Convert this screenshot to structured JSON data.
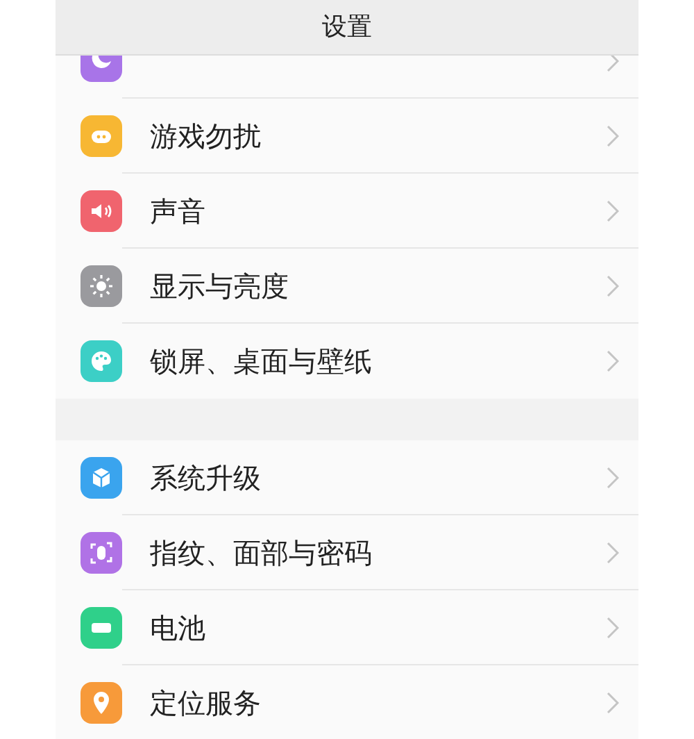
{
  "title": "设置",
  "sections": [
    {
      "items": [
        {
          "kind": "moon",
          "color": "#a874e8"
        },
        {
          "label": "游戏勿扰",
          "kind": "game",
          "color": "#f7b733"
        },
        {
          "label": "声音",
          "kind": "sound",
          "color": "#f0646e"
        },
        {
          "label": "显示与亮度",
          "kind": "sun",
          "color": "#9a9a9e"
        },
        {
          "label": "锁屏、桌面与壁纸",
          "kind": "palette",
          "color": "#3ccfc6"
        }
      ]
    },
    {
      "items": [
        {
          "label": "系统升级",
          "kind": "box",
          "color": "#3aa4ee"
        },
        {
          "label": "指纹、面部与密码",
          "kind": "face",
          "color": "#b072e6"
        },
        {
          "label": "电池",
          "kind": "battery",
          "color": "#2fd08a"
        },
        {
          "label": "定位服务",
          "kind": "pin",
          "color": "#f79a3a"
        }
      ]
    }
  ]
}
